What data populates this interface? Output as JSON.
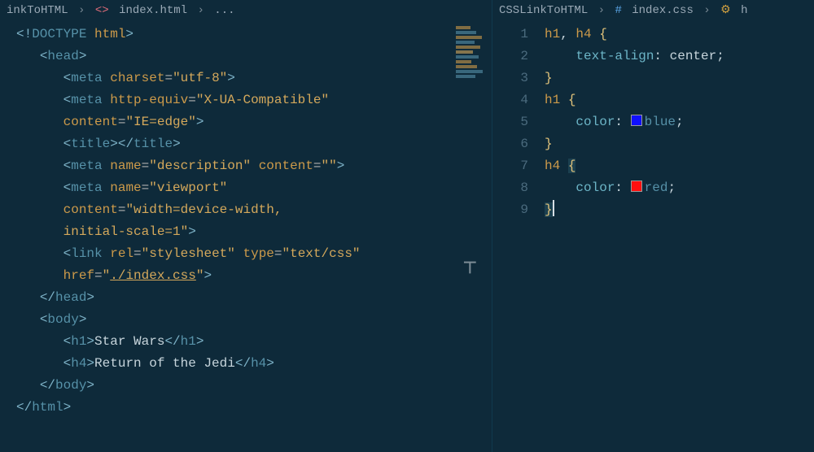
{
  "left": {
    "breadcrumb": {
      "folder": "inkToHTML",
      "file": "index.html",
      "more": "..."
    },
    "lines": [
      [
        {
          "c": "tok-punct",
          "t": "<!"
        },
        {
          "c": "tok-doctype",
          "t": "DOCTYPE "
        },
        {
          "c": "tok-attr",
          "t": "html"
        },
        {
          "c": "tok-punct",
          "t": ">"
        }
      ],
      [
        {
          "t": "   "
        },
        {
          "c": "tok-punct",
          "t": "<"
        },
        {
          "c": "tok-tag",
          "t": "head"
        },
        {
          "c": "tok-punct",
          "t": ">"
        }
      ],
      [
        {
          "t": "      "
        },
        {
          "c": "tok-punct",
          "t": "<"
        },
        {
          "c": "tok-tag",
          "t": "meta "
        },
        {
          "c": "tok-attr",
          "t": "charset"
        },
        {
          "c": "tok-equals",
          "t": "="
        },
        {
          "c": "tok-str",
          "t": "\"utf-8\""
        },
        {
          "c": "tok-punct",
          "t": ">"
        }
      ],
      [
        {
          "t": "      "
        },
        {
          "c": "tok-punct",
          "t": "<"
        },
        {
          "c": "tok-tag",
          "t": "meta "
        },
        {
          "c": "tok-attr",
          "t": "http-equiv"
        },
        {
          "c": "tok-equals",
          "t": "="
        },
        {
          "c": "tok-str",
          "t": "\"X-UA-Compatible\""
        }
      ],
      [
        {
          "t": "      "
        },
        {
          "c": "tok-attr",
          "t": "content"
        },
        {
          "c": "tok-equals",
          "t": "="
        },
        {
          "c": "tok-str",
          "t": "\"IE=edge\""
        },
        {
          "c": "tok-punct",
          "t": ">"
        }
      ],
      [
        {
          "t": "      "
        },
        {
          "c": "tok-punct",
          "t": "<"
        },
        {
          "c": "tok-tag",
          "t": "title"
        },
        {
          "c": "tok-punct",
          "t": ">"
        },
        {
          "c": "tok-punct",
          "t": "</"
        },
        {
          "c": "tok-tag",
          "t": "title"
        },
        {
          "c": "tok-punct",
          "t": ">"
        }
      ],
      [
        {
          "t": "      "
        },
        {
          "c": "tok-punct",
          "t": "<"
        },
        {
          "c": "tok-tag",
          "t": "meta "
        },
        {
          "c": "tok-attr",
          "t": "name"
        },
        {
          "c": "tok-equals",
          "t": "="
        },
        {
          "c": "tok-str",
          "t": "\"description\""
        },
        {
          "t": " "
        },
        {
          "c": "tok-attr",
          "t": "content"
        },
        {
          "c": "tok-equals",
          "t": "="
        },
        {
          "c": "tok-str",
          "t": "\"\""
        },
        {
          "c": "tok-punct",
          "t": ">"
        }
      ],
      [
        {
          "t": "      "
        },
        {
          "c": "tok-punct",
          "t": "<"
        },
        {
          "c": "tok-tag",
          "t": "meta "
        },
        {
          "c": "tok-attr",
          "t": "name"
        },
        {
          "c": "tok-equals",
          "t": "="
        },
        {
          "c": "tok-str",
          "t": "\"viewport\""
        }
      ],
      [
        {
          "t": "      "
        },
        {
          "c": "tok-attr",
          "t": "content"
        },
        {
          "c": "tok-equals",
          "t": "="
        },
        {
          "c": "tok-str",
          "t": "\"width=device-width,"
        }
      ],
      [
        {
          "t": "      "
        },
        {
          "c": "tok-str",
          "t": "initial-scale=1\""
        },
        {
          "c": "tok-punct",
          "t": ">"
        }
      ],
      [
        {
          "t": "      "
        },
        {
          "c": "tok-punct",
          "t": "<"
        },
        {
          "c": "tok-tag",
          "t": "link "
        },
        {
          "c": "tok-attr",
          "t": "rel"
        },
        {
          "c": "tok-equals",
          "t": "="
        },
        {
          "c": "tok-str",
          "t": "\"stylesheet\""
        },
        {
          "t": " "
        },
        {
          "c": "tok-attr",
          "t": "type"
        },
        {
          "c": "tok-equals",
          "t": "="
        },
        {
          "c": "tok-str",
          "t": "\"text/css\""
        }
      ],
      [
        {
          "t": "      "
        },
        {
          "c": "tok-attr",
          "t": "href"
        },
        {
          "c": "tok-equals",
          "t": "="
        },
        {
          "c": "tok-str",
          "t": "\""
        },
        {
          "c": "tok-str tok-link",
          "t": "./index.css"
        },
        {
          "c": "tok-str",
          "t": "\""
        },
        {
          "c": "tok-punct",
          "t": ">"
        }
      ],
      [
        {
          "t": "   "
        },
        {
          "c": "tok-punct",
          "t": "</"
        },
        {
          "c": "tok-tag",
          "t": "head"
        },
        {
          "c": "tok-punct",
          "t": ">"
        }
      ],
      [
        {
          "t": "   "
        },
        {
          "c": "tok-punct",
          "t": "<"
        },
        {
          "c": "tok-tag",
          "t": "body"
        },
        {
          "c": "tok-punct",
          "t": ">"
        }
      ],
      [
        {
          "t": "      "
        },
        {
          "c": "tok-punct",
          "t": "<"
        },
        {
          "c": "tok-tag",
          "t": "h1"
        },
        {
          "c": "tok-punct",
          "t": ">"
        },
        {
          "c": "tok-text",
          "t": "Star Wars"
        },
        {
          "c": "tok-punct",
          "t": "</"
        },
        {
          "c": "tok-tag",
          "t": "h1"
        },
        {
          "c": "tok-punct",
          "t": ">"
        }
      ],
      [
        {
          "t": "      "
        },
        {
          "c": "tok-punct",
          "t": "<"
        },
        {
          "c": "tok-tag",
          "t": "h4"
        },
        {
          "c": "tok-punct",
          "t": ">"
        },
        {
          "c": "tok-text",
          "t": "Return of the Jedi"
        },
        {
          "c": "tok-punct",
          "t": "</"
        },
        {
          "c": "tok-tag",
          "t": "h4"
        },
        {
          "c": "tok-punct",
          "t": ">"
        }
      ],
      [
        {
          "t": "   "
        },
        {
          "c": "tok-punct",
          "t": "</"
        },
        {
          "c": "tok-tag",
          "t": "body"
        },
        {
          "c": "tok-punct",
          "t": ">"
        }
      ],
      [
        {
          "c": "tok-punct",
          "t": "</"
        },
        {
          "c": "tok-tag",
          "t": "html"
        },
        {
          "c": "tok-punct",
          "t": ">"
        }
      ]
    ]
  },
  "right": {
    "breadcrumb": {
      "folder": "CSSLinkToHTML",
      "file": "index.css",
      "symbol": "h"
    },
    "lineNumbers": [
      "1",
      "2",
      "3",
      "4",
      "5",
      "6",
      "7",
      "8",
      "9"
    ],
    "lines": [
      [
        {
          "c": "tok-sel",
          "t": "h1"
        },
        {
          "c": "tok-comma",
          "t": ", "
        },
        {
          "c": "tok-sel",
          "t": "h4"
        },
        {
          "t": " "
        },
        {
          "c": "tok-brace",
          "t": "{"
        }
      ],
      [
        {
          "t": "    "
        },
        {
          "c": "tok-prop",
          "t": "text-align"
        },
        {
          "c": "tok-colon",
          "t": ": "
        },
        {
          "c": "tok-val",
          "t": "center"
        },
        {
          "c": "tok-colon",
          "t": ";"
        }
      ],
      [
        {
          "c": "tok-brace",
          "t": "}"
        }
      ],
      [
        {
          "c": "tok-sel",
          "t": "h1"
        },
        {
          "t": " "
        },
        {
          "c": "tok-brace",
          "t": "{"
        }
      ],
      [
        {
          "t": "    "
        },
        {
          "c": "tok-prop",
          "t": "color"
        },
        {
          "c": "tok-colon",
          "t": ": "
        },
        {
          "swatch": "#1010ff"
        },
        {
          "c": "tok-color",
          "t": "blue"
        },
        {
          "c": "tok-colon",
          "t": ";"
        }
      ],
      [
        {
          "c": "tok-brace",
          "t": "}"
        }
      ],
      [
        {
          "c": "tok-sel",
          "t": "h4"
        },
        {
          "t": " "
        },
        {
          "c": "tok-brace sel",
          "t": "{"
        }
      ],
      [
        {
          "t": "    "
        },
        {
          "c": "tok-prop",
          "t": "color"
        },
        {
          "c": "tok-colon",
          "t": ": "
        },
        {
          "swatch": "#ff1010"
        },
        {
          "c": "tok-color",
          "t": "red"
        },
        {
          "c": "tok-colon",
          "t": ";"
        }
      ],
      [
        {
          "c": "tok-brace sel",
          "t": "}"
        },
        {
          "cursor": true
        }
      ]
    ]
  },
  "minimap": [
    "#cc9a4a",
    "#5691a8",
    "#cc9a4a",
    "#5691a8",
    "#cc9a4a",
    "#d4a85b",
    "#5691a8",
    "#cc9a4a",
    "#cc9a4a",
    "#5691a8",
    "#5691a8"
  ]
}
